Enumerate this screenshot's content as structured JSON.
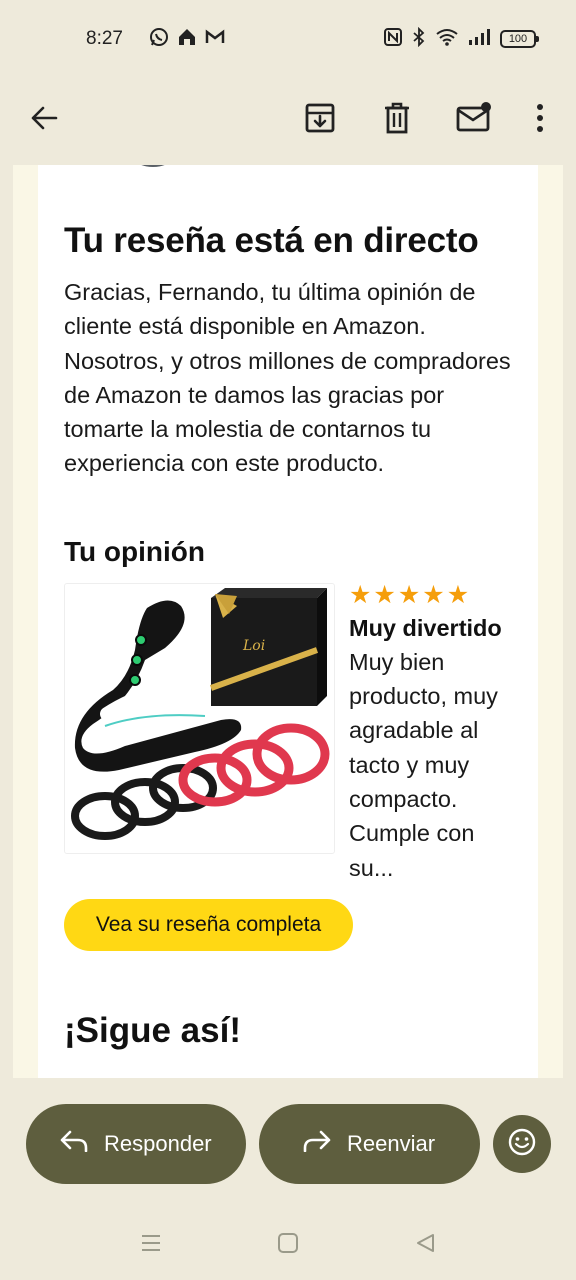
{
  "status": {
    "time": "8:27",
    "battery": "100"
  },
  "toolbar": {
    "back_icon": "arrow-left-icon",
    "archive_icon": "archive-icon",
    "delete_icon": "trash-icon",
    "mark_unread_icon": "mail-unread-icon",
    "more_icon": "more-vert-icon"
  },
  "email": {
    "headline": "Tu reseña está en directo",
    "body": "Gracias, Fernando, tu última opinión de cliente está disponible en Amazon. Nosotros, y otros millones de compradores de Amazon te damos las gracias por tomarte la molestia de contarnos tu experiencia con este producto.",
    "section_title": "Tu opinión",
    "review": {
      "rating": 5,
      "title": "Muy divertido",
      "text": "Muy bien producto, muy agradable al tacto y muy compacto. Cumple con su..."
    },
    "cta_label": "Vea su reseña completa",
    "closing_heading": "¡Sigue así!"
  },
  "actions": {
    "reply_label": "Responder",
    "forward_label": "Reenviar"
  },
  "colors": {
    "background": "#eeeadb",
    "action_button": "#5e5e3e",
    "cta": "#ffd814",
    "star": "#f59e0b"
  }
}
